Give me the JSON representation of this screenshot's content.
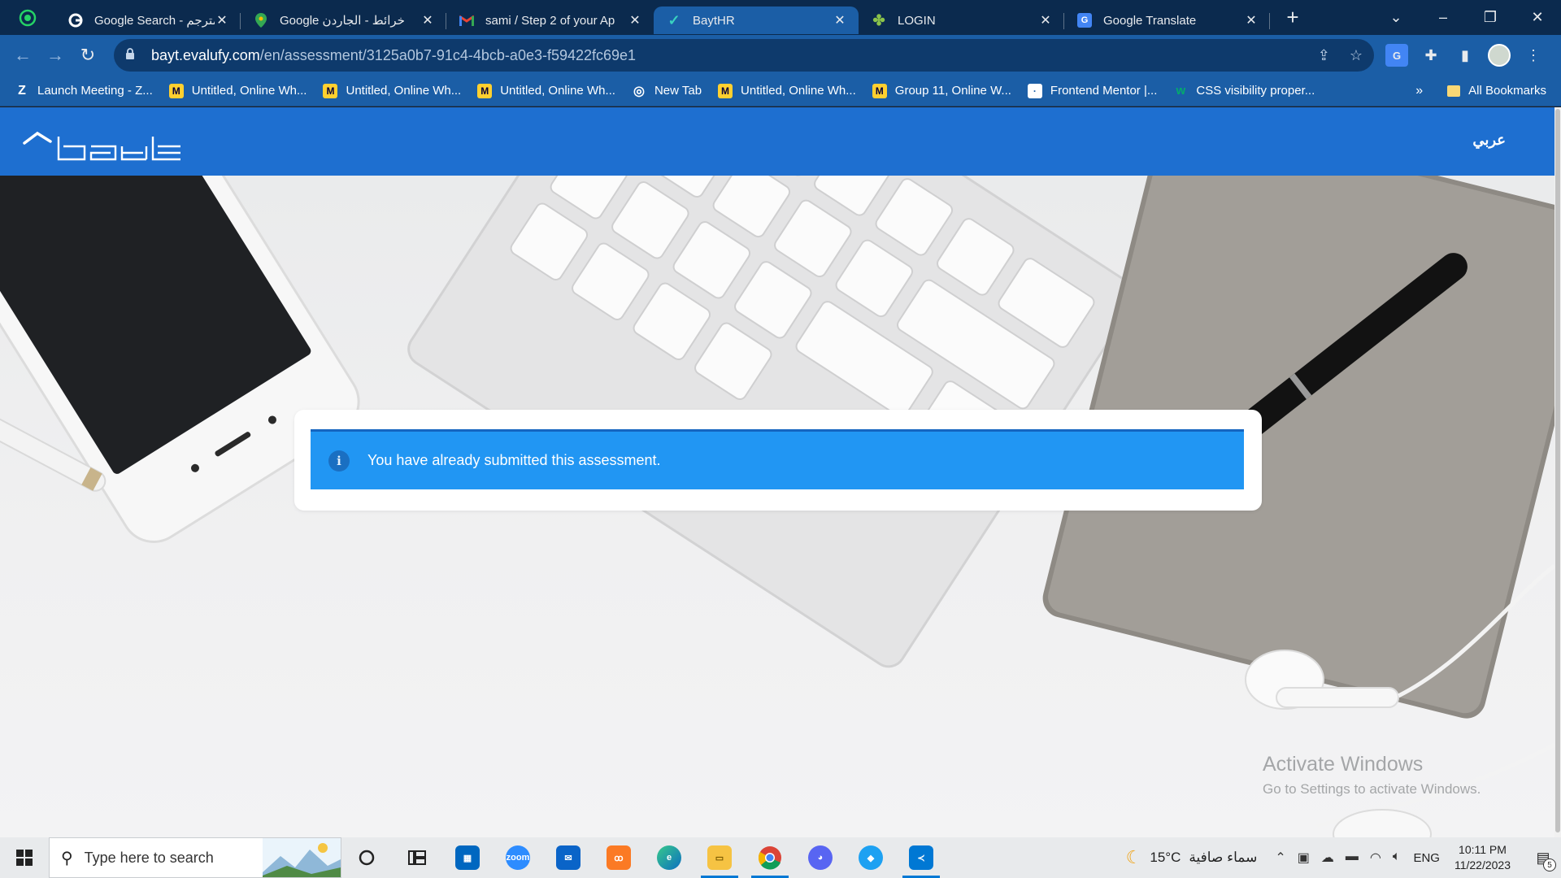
{
  "browser": {
    "tabs": [
      {
        "title": "Google Search - مترجم",
        "icon": "google-g-icon"
      },
      {
        "title": "Google خرائط - الجاردن",
        "icon": "google-maps-icon"
      },
      {
        "title": "sami / Step 2 of your Ap",
        "icon": "gmail-icon"
      },
      {
        "title": "BaytHR",
        "icon": "baythr-check-icon",
        "active": true
      },
      {
        "title": "LOGIN",
        "icon": "clover-icon"
      },
      {
        "title": "Google Translate",
        "icon": "google-translate-icon"
      }
    ],
    "address": {
      "host": "bayt.evalufy.com",
      "path": "/en/assessment/3125a0b7-91c4-4bcb-a0e3-f59422fc69e1"
    },
    "bookmarks": [
      {
        "label": "Launch Meeting - Z...",
        "icon": "zoom-icon"
      },
      {
        "label": "Untitled, Online Wh...",
        "icon": "miro-icon"
      },
      {
        "label": "Untitled, Online Wh...",
        "icon": "miro-icon"
      },
      {
        "label": "Untitled, Online Wh...",
        "icon": "miro-icon"
      },
      {
        "label": "New Tab",
        "icon": "globe-icon"
      },
      {
        "label": "Untitled, Online Wh...",
        "icon": "miro-icon"
      },
      {
        "label": "Group 11, Online W...",
        "icon": "miro-icon"
      },
      {
        "label": "Frontend Mentor |...",
        "icon": "frontend-mentor-icon"
      },
      {
        "label": "CSS visibility proper...",
        "icon": "w3schools-icon"
      }
    ],
    "all_bookmarks": "All Bookmarks",
    "overflow": "»"
  },
  "site": {
    "language_link": "عربي",
    "brand_color": "#1e6fd0",
    "alert": {
      "message": "You have already submitted this assessment.",
      "color": "#2196f3"
    }
  },
  "watermark": {
    "line1": "Activate Windows",
    "line2": "Go to Settings to activate Windows."
  },
  "taskbar": {
    "search_placeholder": "Type here to search",
    "weather_temp": "15°C",
    "weather_desc": "سماء صافية",
    "language": "ENG",
    "time": "10:11 PM",
    "date": "11/22/2023",
    "notifications": "5",
    "apps": [
      "cortana-circle-icon",
      "task-view-icon",
      "microsoft-store-icon",
      "zoom-icon",
      "mail-icon",
      "xampp-icon",
      "edge-icon",
      "file-explorer-icon",
      "chrome-icon",
      "discord-icon",
      "blue-app-icon",
      "vscode-icon"
    ]
  }
}
